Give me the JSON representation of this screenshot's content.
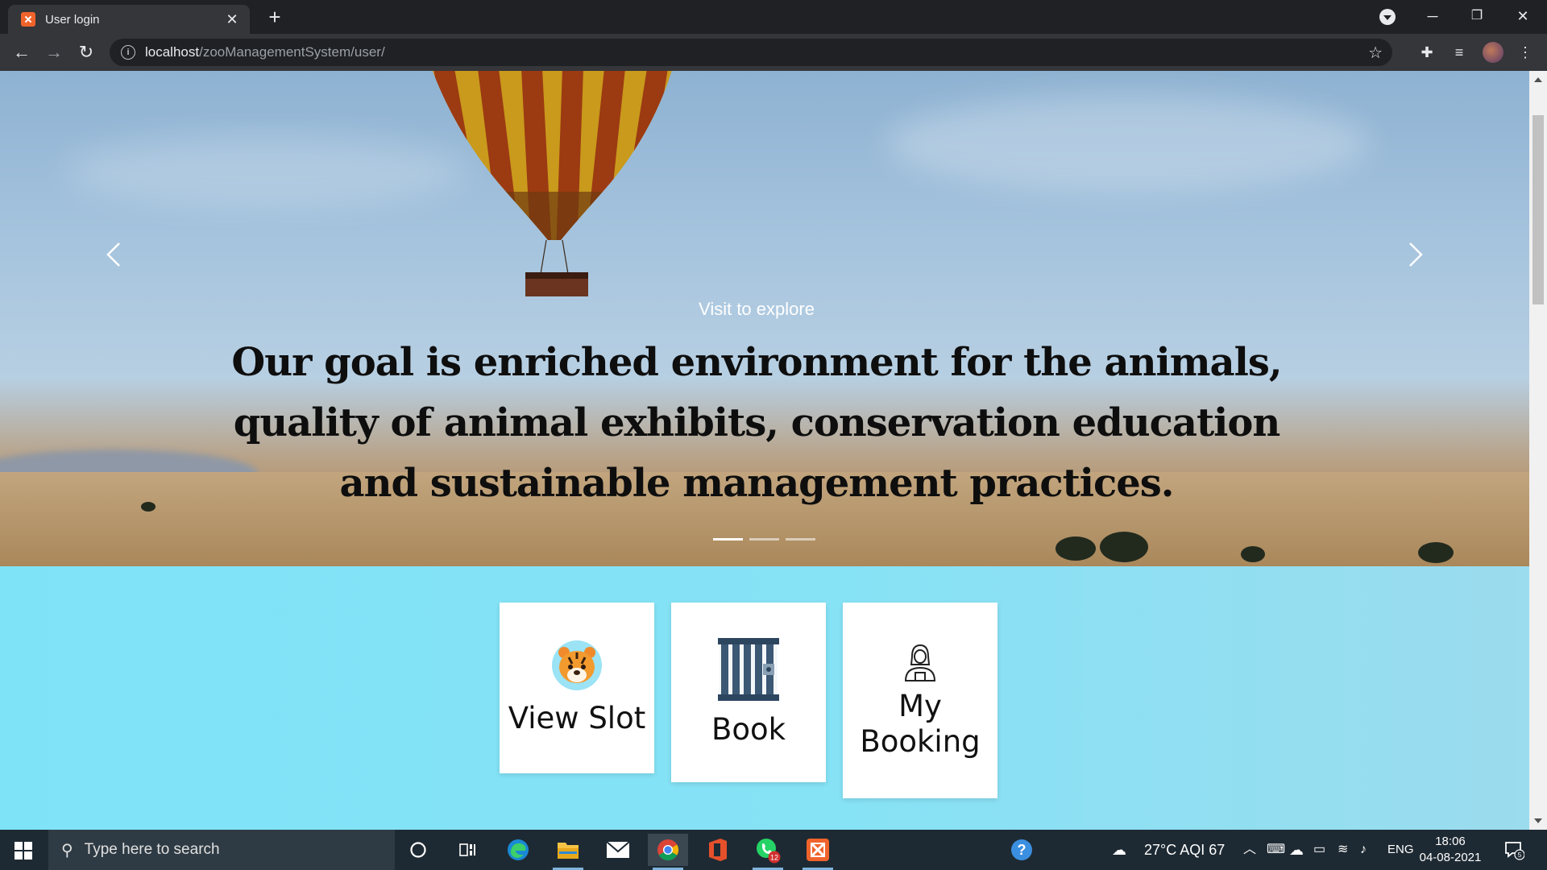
{
  "browser": {
    "tab_title": "User login",
    "tab_close": "✕",
    "new_tab": "+",
    "url_host": "localhost",
    "url_path": "/zooManagementSystem/user/",
    "win_minimize": "─",
    "win_restore": "❐",
    "win_close": "✕"
  },
  "hero": {
    "subtitle": "Visit to explore",
    "title": "Our goal is enriched environment for the animals, quality of animal exhibits, conservation education and sustainable management practices.",
    "slides": 3,
    "active_slide": 1
  },
  "cards": [
    {
      "label": "View Slot",
      "icon": "tiger-icon"
    },
    {
      "label": "Book",
      "icon": "cage-icon"
    },
    {
      "label": "My Booking",
      "icon": "person-icon"
    }
  ],
  "taskbar": {
    "search_placeholder": "Type here to search",
    "weather": "27°C  AQI 67",
    "language": "ENG",
    "time": "18:06",
    "date": "04-08-2021",
    "whatsapp_badge": "12",
    "notification_count": "5"
  },
  "colors": {
    "lower_bg": "#80e4f8",
    "chrome_dark": "#202124",
    "chrome_toolbar": "#35363a",
    "taskbar": "#1e2a33"
  }
}
